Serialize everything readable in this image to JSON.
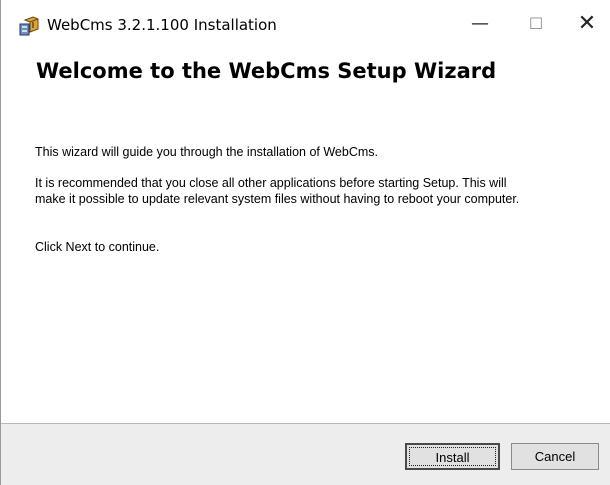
{
  "window": {
    "title": "WebCms 3.2.1.100 Installation",
    "minimize_symbol": "—",
    "maximize_symbol": "☐",
    "close_symbol": "✕",
    "icon": "installer-package-icon"
  },
  "page": {
    "heading": "Welcome to the WebCms Setup Wizard",
    "paragraph_1": "This wizard will guide you through the installation of WebCms.",
    "paragraph_2": "It is recommended that you close all other applications before starting Setup. This will make it possible to update relevant system files without having to reboot your computer.",
    "paragraph_3": "Click Next to continue."
  },
  "footer": {
    "install_label": "Install",
    "cancel_label": "Cancel"
  },
  "colors": {
    "footer_background": "#ededed",
    "button_face": "#e1e1e1",
    "default_button_border": "#4a4a4a"
  }
}
